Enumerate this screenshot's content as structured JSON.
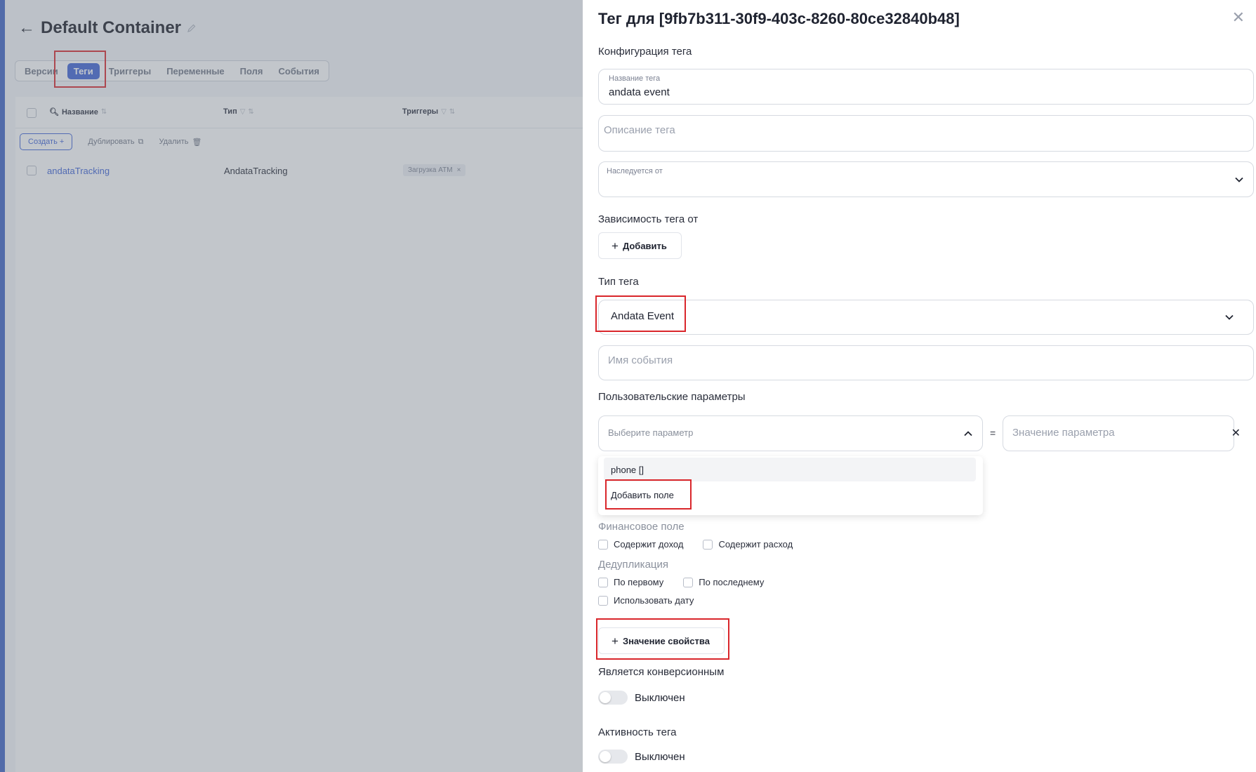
{
  "background": {
    "title": "Default Container",
    "tabs": [
      "Версии",
      "Теги",
      "Триггеры",
      "Переменные",
      "Поля",
      "События"
    ],
    "active_tab": "Теги",
    "columns": {
      "name": "Название",
      "type": "Тип",
      "triggers": "Триггеры"
    },
    "toolbar": {
      "create": "Создать",
      "duplicate": "Дублировать",
      "delete": "Удалить"
    },
    "rows": [
      {
        "name": "andataTracking",
        "type": "AndataTracking",
        "trigger": "Загрузка ATM"
      }
    ]
  },
  "drawer": {
    "title": "Тег для [9fb7b311-30f9-403c-8260-80ce32840b48]",
    "config_label": "Конфигурация тега",
    "name_label": "Название тега",
    "name_value": "andata event",
    "description_placeholder": "Описание тега",
    "inherits_label": "Наследуется от",
    "dependency_label": "Зависимость тега от",
    "add_label": "Добавить",
    "type_label": "Тип тега",
    "type_value": "Andata Event",
    "event_name_placeholder": "Имя события",
    "custom_params_label": "Пользовательские параметры",
    "param_select_placeholder": "Выберите параметр",
    "equals": "=",
    "param_value_placeholder": "Значение параметра",
    "dropdown_options": [
      "phone []",
      "Добавить поле"
    ],
    "financial_label": "Финансовое поле",
    "income_label": "Содержит доход",
    "expense_label": "Содержит расход",
    "dedup_label": "Дедупликация",
    "by_first_label": "По первому",
    "by_last_label": "По последнему",
    "use_date_label": "Использовать дату",
    "property_value_label": "Значение свойства",
    "conversion_label": "Является конверсионным",
    "conversion_state": "Выключен",
    "activity_label": "Активность тега",
    "activity_state": "Выключен"
  },
  "colors": {
    "accent": "#3e63d6",
    "highlight": "#d9262b"
  }
}
